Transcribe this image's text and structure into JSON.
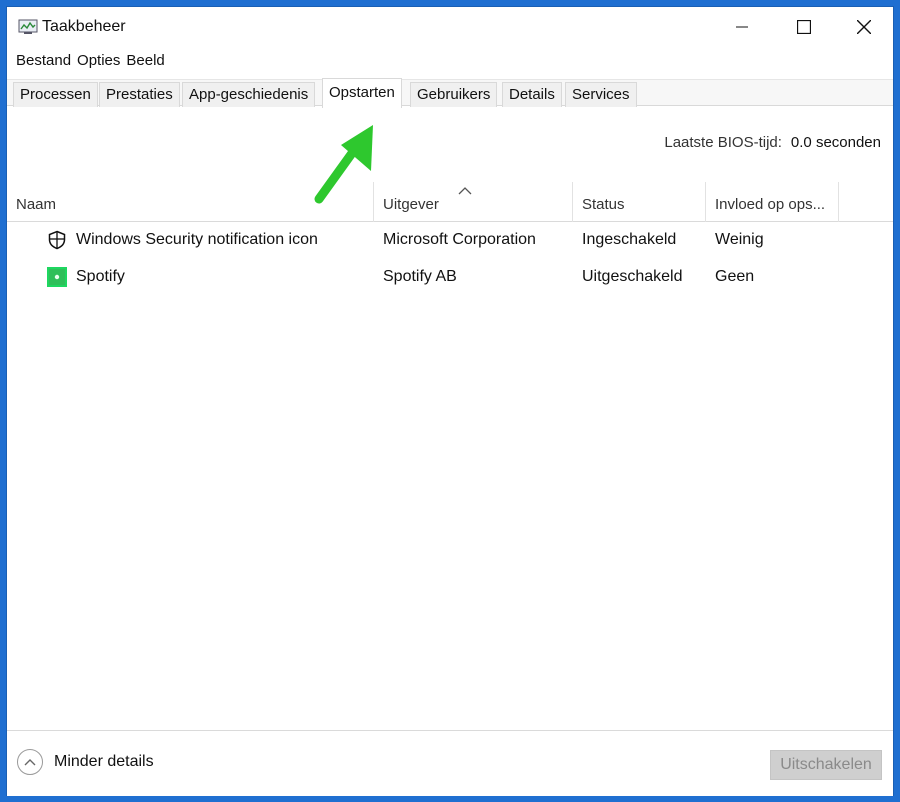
{
  "window": {
    "title": "Taakbeheer",
    "controls": {
      "minimize": "minimize-icon",
      "maximize": "maximize-icon",
      "close": "close-icon"
    }
  },
  "menu": {
    "items": [
      "Bestand",
      "Opties",
      "Beeld"
    ]
  },
  "tabs": [
    {
      "label": "Processen",
      "active": false
    },
    {
      "label": "Prestaties",
      "active": false
    },
    {
      "label": "App-geschiedenis",
      "active": false
    },
    {
      "label": "Opstarten",
      "active": true
    },
    {
      "label": "Gebruikers",
      "active": false
    },
    {
      "label": "Details",
      "active": false
    },
    {
      "label": "Services",
      "active": false
    }
  ],
  "bios": {
    "label": "Laatste BIOS-tijd:",
    "value": "0.0 seconden"
  },
  "table": {
    "columns": [
      "Naam",
      "Uitgever",
      "Status",
      "Invloed op ops..."
    ],
    "sorted_column": "Uitgever",
    "rows": [
      {
        "icon": "shield-icon",
        "name": "Windows Security notification icon",
        "publisher": "Microsoft Corporation",
        "status": "Ingeschakeld",
        "impact": "Weinig"
      },
      {
        "icon": "spotify-icon",
        "name": "Spotify",
        "publisher": "Spotify AB",
        "status": "Uitgeschakeld",
        "impact": "Geen"
      }
    ]
  },
  "footer": {
    "less_details": "Minder details",
    "disable_button": "Uitschakelen"
  },
  "colors": {
    "accent": "#1f6fd1",
    "arrow": "#2ec82e",
    "spotify": "#1ed760"
  }
}
